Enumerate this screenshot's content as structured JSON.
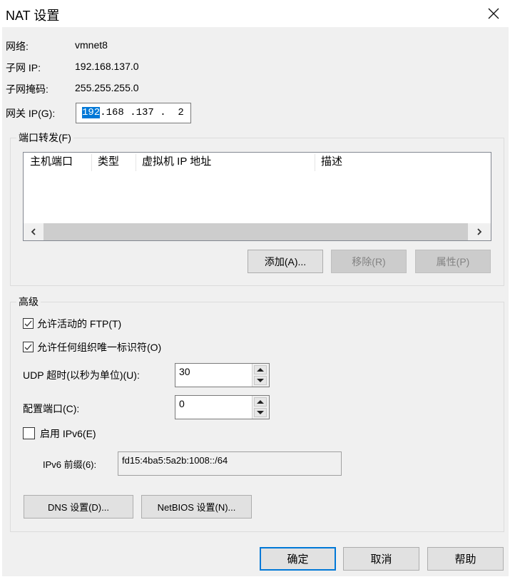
{
  "window": {
    "title": "NAT 设置",
    "close_icon": "close-icon"
  },
  "info": {
    "network_label": "网络:",
    "network_value": "vmnet8",
    "subnet_ip_label": "子网 IP:",
    "subnet_ip_value": "192.168.137.0",
    "subnet_mask_label": "子网掩码:",
    "subnet_mask_value": "255.255.255.0",
    "gateway_label": "网关 IP(G):",
    "gateway_octets": [
      "192",
      "168",
      "137",
      "2"
    ],
    "gateway_selected": "192",
    "gateway_rest": ".168 .137 .  2"
  },
  "port_forwarding": {
    "group_title": "端口转发(F)",
    "columns": [
      "主机端口",
      "类型",
      "虚拟机 IP 地址",
      "描述"
    ],
    "rows": [],
    "scroll_left_icon": "chevron-left-icon",
    "scroll_right_icon": "chevron-right-icon",
    "add_label": "添加(A)...",
    "remove_label": "移除(R)",
    "properties_label": "属性(P)"
  },
  "advanced": {
    "group_title": "高级",
    "allow_ftp_label": "允许活动的 FTP(T)",
    "allow_ftp_checked": true,
    "allow_oui_label": "允许任何组织唯一标识符(O)",
    "allow_oui_checked": true,
    "udp_timeout_label": "UDP 超时(以秒为单位)(U):",
    "udp_timeout_value": "30",
    "config_port_label": "配置端口(C):",
    "config_port_value": "0",
    "enable_ipv6_label": "启用 IPv6(E)",
    "enable_ipv6_checked": false,
    "ipv6_prefix_label": "IPv6 前缀(6):",
    "ipv6_prefix_value": "fd15:4ba5:5a2b:1008::/64",
    "dns_label": "DNS 设置(D)...",
    "netbios_label": "NetBIOS 设置(N)..."
  },
  "footer": {
    "ok_label": "确定",
    "cancel_label": "取消",
    "help_label": "帮助"
  },
  "colors": {
    "accent": "#0078d7",
    "dialog_bg": "#f0f0f0",
    "disabled_button_bg": "#cccccc"
  }
}
